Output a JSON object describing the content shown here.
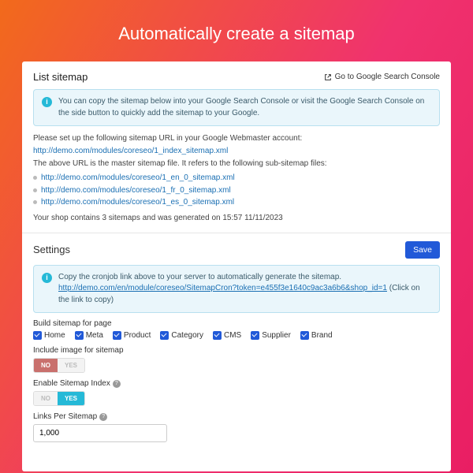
{
  "hero": {
    "title": "Automatically create a sitemap"
  },
  "list_sitemap": {
    "title": "List sitemap",
    "gsc_link": "Go to Google Search Console",
    "alert": "You can copy the sitemap below into your Google Search Console or visit the Google Search Console on the side button to quickly add the sitemap to your Google.",
    "setup_line": "Please set up the following sitemap URL in your Google Webmaster account:",
    "master_url": "http://demo.com/modules/coreseo/1_index_sitemap.xml",
    "sub_intro": "The above URL is the master sitemap file. It refers to the following sub-sitemap files:",
    "sub_urls": [
      "http://demo.com/modules/coreseo/1_en_0_sitemap.xml",
      "http://demo.com/modules/coreseo/1_fr_0_sitemap.xml",
      "http://demo.com/modules/coreseo/1_es_0_sitemap.xml"
    ],
    "summary": "Your shop contains 3 sitemaps and was generated on 15:57 11/11/2023"
  },
  "settings": {
    "title": "Settings",
    "save_label": "Save",
    "cron_alert_pre": "Copy the cronjob link above to your server to automatically generate the sitemap.",
    "cron_url": "http://demo.com/en/module/coreseo/SitemapCron?token=e455f3e1640c9ac3a6b6&shop_id=1",
    "cron_alert_post": " (Click on the link to copy)",
    "build_label": "Build sitemap for page",
    "checks": [
      "Home",
      "Meta",
      "Product",
      "Category",
      "CMS",
      "Supplier",
      "Brand"
    ],
    "include_image_label": "Include image for sitemap",
    "include_image_value": "NO",
    "toggle_no": "No",
    "toggle_yes": "Yes",
    "enable_index_label": "Enable Sitemap Index",
    "enable_index_value": "YES",
    "links_per_label": "Links Per Sitemap",
    "links_per_value": "1,000"
  }
}
